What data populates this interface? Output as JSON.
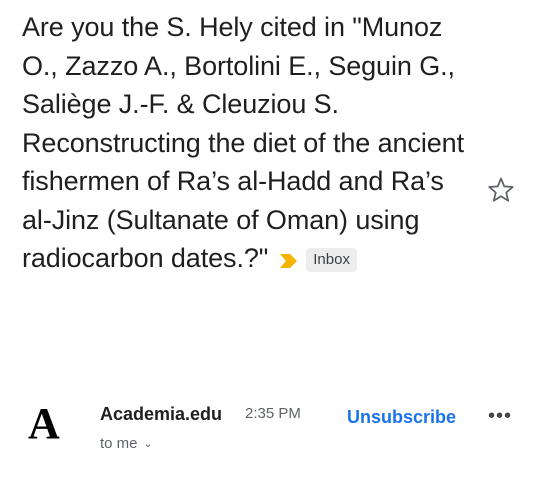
{
  "email": {
    "subject": "Are you the S. Hely cited in \"Munoz O., Zazzo A., Bortolini E., Seguin G., Saliège J.-F. & Cleuziou S. Reconstructing the diet of the ancient fishermen of Ra’s al-Hadd and Ra’s al-Jinz (Sultanate of Oman) using radiocarbon dates.?\"",
    "label": "Inbox",
    "importance_icon": "importance-marker-icon",
    "star_icon": "star-outline-icon"
  },
  "sender": {
    "avatar_letter": "A",
    "name": "Academia.edu",
    "time": "2:35 PM",
    "unsubscribe_label": "Unsubscribe",
    "more_label": "•••",
    "recipient": "to me",
    "recipient_chevron": "⌄"
  },
  "colors": {
    "importance": "#f4b400",
    "link": "#1a73e8",
    "chip_bg": "#ededed"
  }
}
